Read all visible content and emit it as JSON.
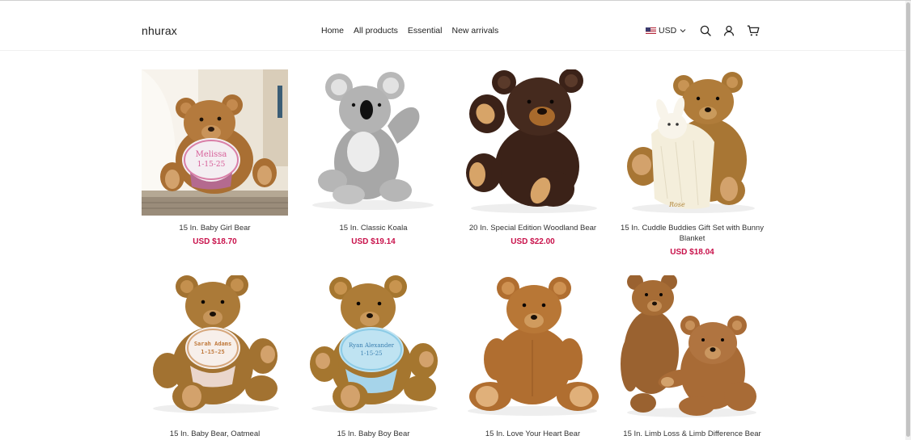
{
  "header": {
    "logo": "nhurax",
    "nav": [
      "Home",
      "All products",
      "Essential",
      "New arrivals"
    ],
    "currency": "USD"
  },
  "colors": {
    "price": "#c8104a",
    "text": "#333333"
  },
  "icons": [
    "search-icon",
    "account-icon",
    "cart-icon",
    "chevron-down-icon",
    "us-flag-icon"
  ],
  "products": [
    {
      "title": "15 In. Baby Girl Bear",
      "price": "USD $18.70"
    },
    {
      "title": "15 In. Classic Koala",
      "price": "USD $19.14"
    },
    {
      "title": "20 In. Special Edition Woodland Bear",
      "price": "USD $22.00"
    },
    {
      "title": "15 In. Cuddle Buddies Gift Set with Bunny Blanket",
      "price": "USD $18.04"
    },
    {
      "title": "15 In. Baby Bear, Oatmeal",
      "price": ""
    },
    {
      "title": "15 In. Baby Boy Bear",
      "price": ""
    },
    {
      "title": "15 In. Love Your Heart Bear",
      "price": ""
    },
    {
      "title": "15 In. Limb Loss & Limb Difference Bear",
      "price": ""
    }
  ],
  "product_image_text": {
    "bib_girl": [
      "Melissa",
      "1-15-25"
    ],
    "bib_oatmeal": [
      "Sarah Adams",
      "1-15-25"
    ],
    "bib_boy": [
      "Ryan Alexander",
      "1-15-25"
    ],
    "blanket": "Rose"
  }
}
